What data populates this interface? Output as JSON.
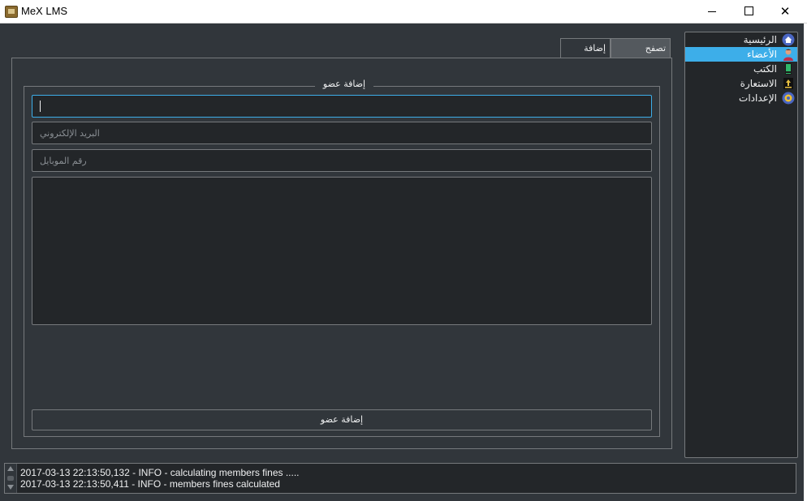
{
  "window": {
    "title": "MeX LMS",
    "minimize": "minimize",
    "maximize": "maximize",
    "close": "✕"
  },
  "sidebar": {
    "items": [
      {
        "label": "الرئيسية",
        "icon": "home-icon",
        "active": false
      },
      {
        "label": "الأعضاء",
        "icon": "member-icon",
        "active": true
      },
      {
        "label": "الكتب",
        "icon": "book-icon",
        "active": false
      },
      {
        "label": "الاستعارة",
        "icon": "borrow-icon",
        "active": false
      },
      {
        "label": "الإعدادات",
        "icon": "settings-icon",
        "active": false
      }
    ]
  },
  "tabs": [
    {
      "label": "تصفح الأعضاء",
      "selected": false
    },
    {
      "label": "إضافة عضو",
      "selected": true
    }
  ],
  "form": {
    "group_title": "إضافة عضو",
    "name_value": "",
    "email_placeholder": "البريد الإلكتروني",
    "mobile_placeholder": "رقم الموبايل",
    "notes_value": "",
    "submit_label": "إضافة عضو"
  },
  "log": {
    "lines": [
      "2017-03-13 22:13:50,132 - INFO - calculating members fines .....",
      "2017-03-13 22:13:50,411 - INFO - members fines calculated"
    ]
  },
  "colors": {
    "accent": "#3daee9",
    "background": "#31363b",
    "field": "#232629",
    "border": "#76797c"
  }
}
